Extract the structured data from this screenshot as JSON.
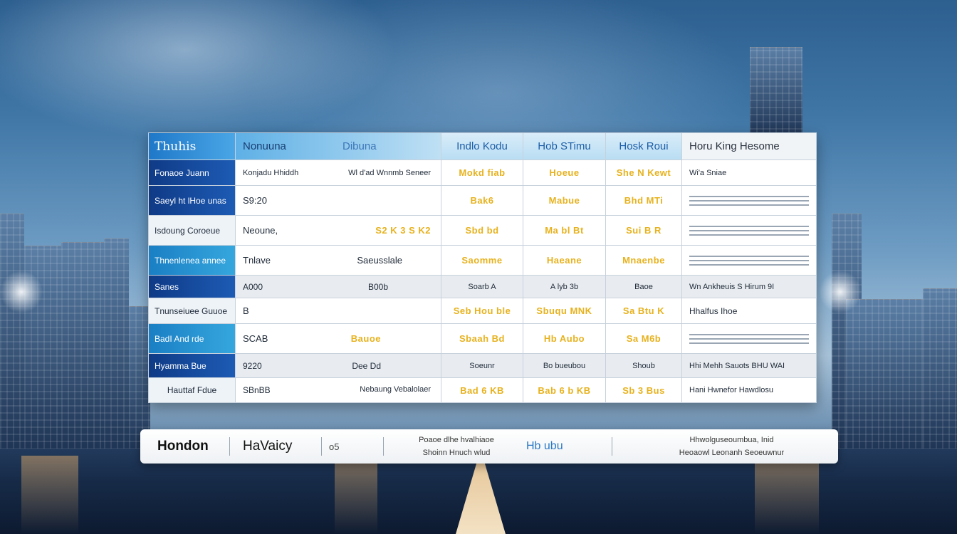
{
  "table": {
    "header": [
      "Thuhis",
      "Nonuuna",
      "Dibuna",
      "Indlo Kodu",
      "Hob STimu",
      "Hosk Roui",
      "Horu King Hesome"
    ],
    "rows": [
      {
        "label": "Fonaoe Juann",
        "c1a": "Konjadu Hhiddh",
        "c1b": "Wl d'ad Wnnmb Seneer",
        "c2": "Mokd fiab",
        "c3": "Hoeue",
        "c4": "She N Kewt",
        "c5": "Wi'a Sniae"
      },
      {
        "label": "Saeyl ht lHoe unas",
        "c1a": "S9:20",
        "c1b": "",
        "c2": "Bak6",
        "c3": "Mabue",
        "c4": "Bhd MTi",
        "c5": ""
      },
      {
        "label": "Isdoung Coroeue",
        "c1a": "Neoune,",
        "c1b": "S2 K 3 S K2",
        "c2": "Sbd bd",
        "c3": "Ma bl Bt",
        "c4": "Sui B R",
        "c5": ""
      },
      {
        "label": "Thnenlenea annee",
        "c1a": "Tnlave",
        "c1b": "Saeusslale",
        "c2": "Saomme",
        "c3": "Haeane",
        "c4": "Mnaenbe",
        "c5": ""
      },
      {
        "label": "Sanes",
        "c1a": "A000",
        "c1b": "B00b",
        "c2": "Soarb A",
        "c3": "A lyb 3b",
        "c4": "Baoe",
        "c5": "Wn Ankheuis S Hirum 9I"
      },
      {
        "label": "Tnunseiuee Guuoe",
        "c1a": "B",
        "c1b": "",
        "c2": "Seb Hou ble",
        "c3": "Sbuqu MNK",
        "c4": "Sa Btu K",
        "c5": "Hhalfus Ihoe"
      },
      {
        "label": "BadI And rde",
        "c1a": "SCAB",
        "c1b": "Bauoe",
        "c2": "Sbaah Bd",
        "c3": "Hb Aubo",
        "c4": "Sa M6b",
        "c5": ""
      },
      {
        "label": "Hyamma Bue",
        "c1a": "9220",
        "c1b": "Dee Dd",
        "c2": "Soeunr",
        "c3": "Bo bueubou",
        "c4": "Shoub",
        "c5": "Hhi Mehh Sauots BHU WAI"
      },
      {
        "label": "Hauttaf Fdue",
        "c1a": "SBnBB",
        "c1b": "Nebaung Vebalolaer",
        "c2": "Bad 6 KB",
        "c3": "Bab 6 b KB",
        "c4": "Sb 3 Bus",
        "c5": "Hani Hwnefor Hawdlosu"
      }
    ]
  },
  "bottom_bar": {
    "title1": "Hondon",
    "title2": "HaVaicy",
    "small1": "o5",
    "info1_top": "Poaoe dlhe hvalhiaoe",
    "info1_bottom": "Shoinn Hnuch wlud",
    "logo_text": "Hb  ubu",
    "info2_top": "Hhwolguseoumbua, Inid",
    "info2_bottom": "Heoaowl Leonanh Seoeuwnur"
  },
  "colors": {
    "accent_blue": "#1d5bb4",
    "gold_value": "#e7b21e",
    "sky_top": "#2d5f8f"
  }
}
